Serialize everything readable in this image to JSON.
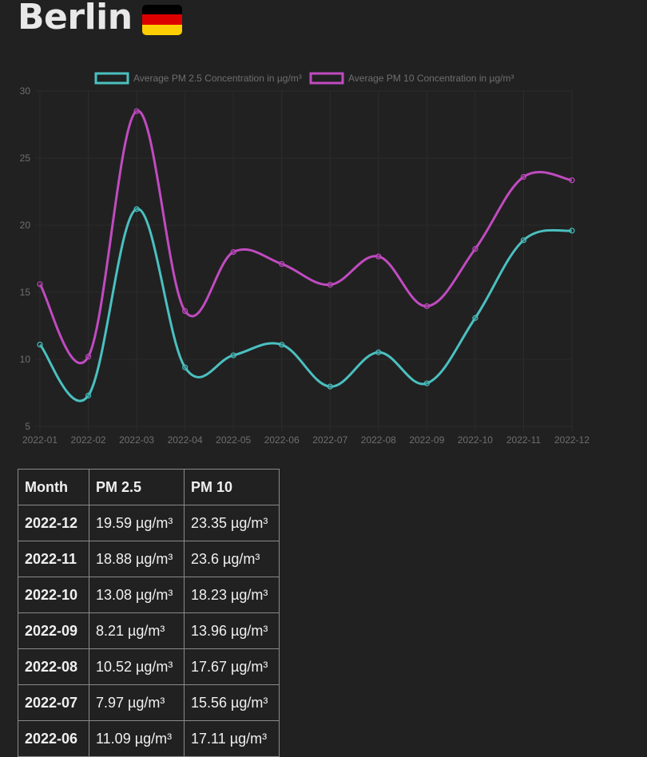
{
  "page": {
    "title": "Berlin",
    "flag_colors": [
      "#000000",
      "#dd0000",
      "#ffce00"
    ]
  },
  "chart_data": {
    "type": "line",
    "categories": [
      "2022-01",
      "2022-02",
      "2022-03",
      "2022-04",
      "2022-05",
      "2022-06",
      "2022-07",
      "2022-08",
      "2022-09",
      "2022-10",
      "2022-11",
      "2022-12"
    ],
    "series": [
      {
        "name": "Average PM 2.5 Concentration in µg/m³",
        "color": "#4bc0c0",
        "values": [
          11.1,
          7.3,
          21.2,
          9.4,
          10.3,
          11.09,
          7.97,
          10.52,
          8.21,
          13.08,
          18.88,
          19.59
        ]
      },
      {
        "name": "Average PM 10 Concentration in µg/m³",
        "color": "#c04bc0",
        "values": [
          15.6,
          10.2,
          28.5,
          13.6,
          18.0,
          17.11,
          15.56,
          17.67,
          13.96,
          18.23,
          23.6,
          23.35
        ]
      }
    ],
    "ylim": [
      5,
      30
    ],
    "yticks": [
      5,
      10,
      15,
      20,
      25,
      30
    ],
    "grid": true,
    "legend": "top-center"
  },
  "table": {
    "headers": [
      "Month",
      "PM 2.5",
      "PM 10"
    ],
    "rows": [
      {
        "month": "2022-12",
        "pm25": "19.59 µg/m³",
        "pm10": "23.35 µg/m³"
      },
      {
        "month": "2022-11",
        "pm25": "18.88 µg/m³",
        "pm10": "23.6 µg/m³"
      },
      {
        "month": "2022-10",
        "pm25": "13.08 µg/m³",
        "pm10": "18.23 µg/m³"
      },
      {
        "month": "2022-09",
        "pm25": "8.21 µg/m³",
        "pm10": "13.96 µg/m³"
      },
      {
        "month": "2022-08",
        "pm25": "10.52 µg/m³",
        "pm10": "17.67 µg/m³"
      },
      {
        "month": "2022-07",
        "pm25": "7.97 µg/m³",
        "pm10": "15.56 µg/m³"
      },
      {
        "month": "2022-06",
        "pm25": "11.09 µg/m³",
        "pm10": "17.11 µg/m³"
      }
    ]
  }
}
